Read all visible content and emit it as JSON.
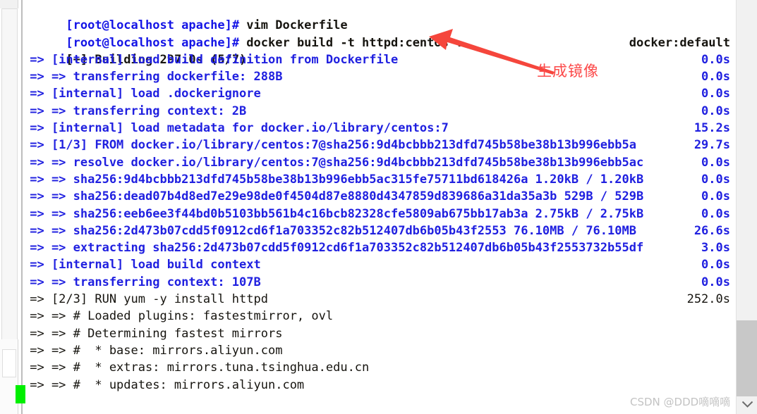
{
  "terminal": {
    "prompt_lines": [
      {
        "prompt": "[root@localhost apache]#",
        "command": " vim Dockerfile"
      },
      {
        "prompt": "[root@localhost apache]#",
        "command": " docker build -t httpd:centos ."
      }
    ],
    "status_line": {
      "text": "[+] Building 297.0s (5/7)",
      "right": "docker:default"
    },
    "steps": [
      {
        "text": " => [internal] load build definition from Dockerfile",
        "time": "0.0s",
        "color": "blue"
      },
      {
        "text": " => => transferring dockerfile: 288B",
        "time": "0.0s",
        "color": "blue"
      },
      {
        "text": " => [internal] load .dockerignore",
        "time": "0.0s",
        "color": "blue"
      },
      {
        "text": " => => transferring context: 2B",
        "time": "0.0s",
        "color": "blue"
      },
      {
        "text": " => [internal] load metadata for docker.io/library/centos:7",
        "time": "15.2s",
        "color": "blue"
      },
      {
        "text": " => [1/3] FROM docker.io/library/centos:7@sha256:9d4bcbbb213dfd745b58be38b13b996ebb5a",
        "time": "29.7s",
        "color": "blue"
      },
      {
        "text": " => => resolve docker.io/library/centos:7@sha256:9d4bcbbb213dfd745b58be38b13b996ebb5ac",
        "time": "0.0s",
        "color": "blue"
      },
      {
        "text": " => => sha256:9d4bcbbb213dfd745b58be38b13b996ebb5ac315fe75711bd618426a 1.20kB / 1.20kB",
        "time": "0.0s",
        "color": "blue"
      },
      {
        "text": " => => sha256:dead07b4d8ed7e29e98de0f4504d87e8880d4347859d839686a31da35a3b 529B / 529B",
        "time": "0.0s",
        "color": "blue"
      },
      {
        "text": " => => sha256:eeb6ee3f44bd0b5103bb561b4c16bcb82328cfe5809ab675bb17ab3a 2.75kB / 2.75kB",
        "time": "0.0s",
        "color": "blue"
      },
      {
        "text": " => => sha256:2d473b07cdd5f0912cd6f1a703352c82b512407db6b05b43f2553 76.10MB / 76.10MB",
        "time": "26.6s",
        "color": "blue"
      },
      {
        "text": " => => extracting sha256:2d473b07cdd5f0912cd6f1a703352c82b512407db6b05b43f2553732b55df",
        "time": "3.0s",
        "color": "blue"
      },
      {
        "text": " => [internal] load build context",
        "time": "0.0s",
        "color": "blue"
      },
      {
        "text": " => => transferring context: 107B",
        "time": "0.0s",
        "color": "blue"
      },
      {
        "text": " => [2/3] RUN yum -y install httpd",
        "time": "252.0s",
        "color": "black"
      },
      {
        "text": " => => # Loaded plugins: fastestmirror, ovl",
        "time": "",
        "color": "black"
      },
      {
        "text": " => => # Determining fastest mirrors",
        "time": "",
        "color": "black"
      },
      {
        "text": " => => #  * base: mirrors.aliyun.com",
        "time": "",
        "color": "black"
      },
      {
        "text": " => => #  * extras: mirrors.tuna.tsinghua.edu.cn",
        "time": "",
        "color": "black"
      },
      {
        "text": " => => #  * updates: mirrors.aliyun.com",
        "time": "",
        "color": "black"
      }
    ]
  },
  "annotation": {
    "label": "生成镜像",
    "arrow_color": "#f5463c",
    "label_color": "#fc4a4a"
  },
  "watermark": {
    "text": "CSDN @DDD嘀嘀嘀"
  },
  "scrollbars": {
    "right_down_arrow": "chevron-down-icon"
  },
  "colors": {
    "text_blue": "#2020e0",
    "text_black": "#16140f",
    "cursor_green": "#00ef00",
    "background": "#ffffff"
  }
}
